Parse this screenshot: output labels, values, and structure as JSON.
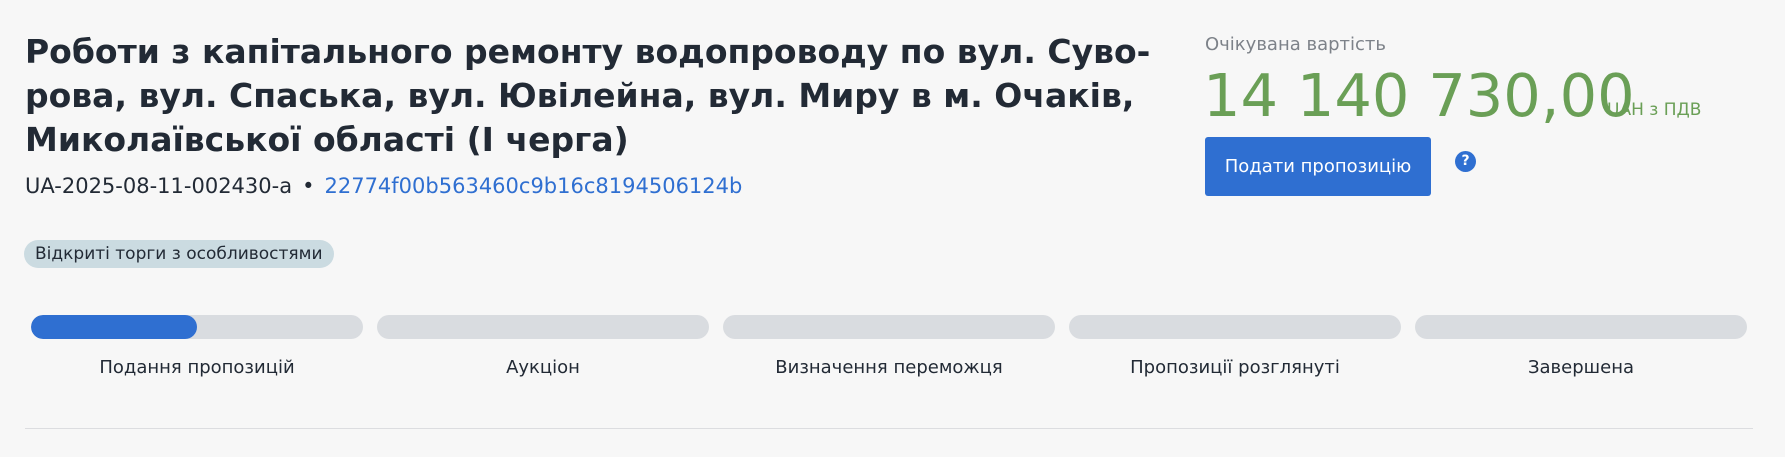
{
  "tender": {
    "title_lines": [
      "Роботи з капітального ремонту водопроводу по вул. Суво-",
      "рова, вул. Спаська, вул. Ювілейна, вул. Миру в м. Очаків,",
      "Миколаївської області (І черга)"
    ],
    "tender_id": "UA-2025-08-11-002430-a",
    "separator": "•",
    "hash": "22774f00b563460c9b16c8194506124b",
    "procedure_badge": "Відкриті торги з особливостями"
  },
  "cost": {
    "label": "Очікувана вартість",
    "amount": "14 140 730,00",
    "currency": "UAH з ПДВ"
  },
  "actions": {
    "submit_label": "Подати пропозицію",
    "help_glyph": "?"
  },
  "stages": [
    {
      "label": "Подання пропозицій",
      "progress": 0.5
    },
    {
      "label": "Аукціон",
      "progress": 0
    },
    {
      "label": "Визначення переможця",
      "progress": 0
    },
    {
      "label": "Пропозиції розглянуті",
      "progress": 0
    },
    {
      "label": "Завершена",
      "progress": 0
    }
  ],
  "colors": {
    "accent": "#2f6fd1",
    "price": "#6a9f56",
    "badge_bg": "#cbdbe1",
    "track": "#d9dce0"
  }
}
